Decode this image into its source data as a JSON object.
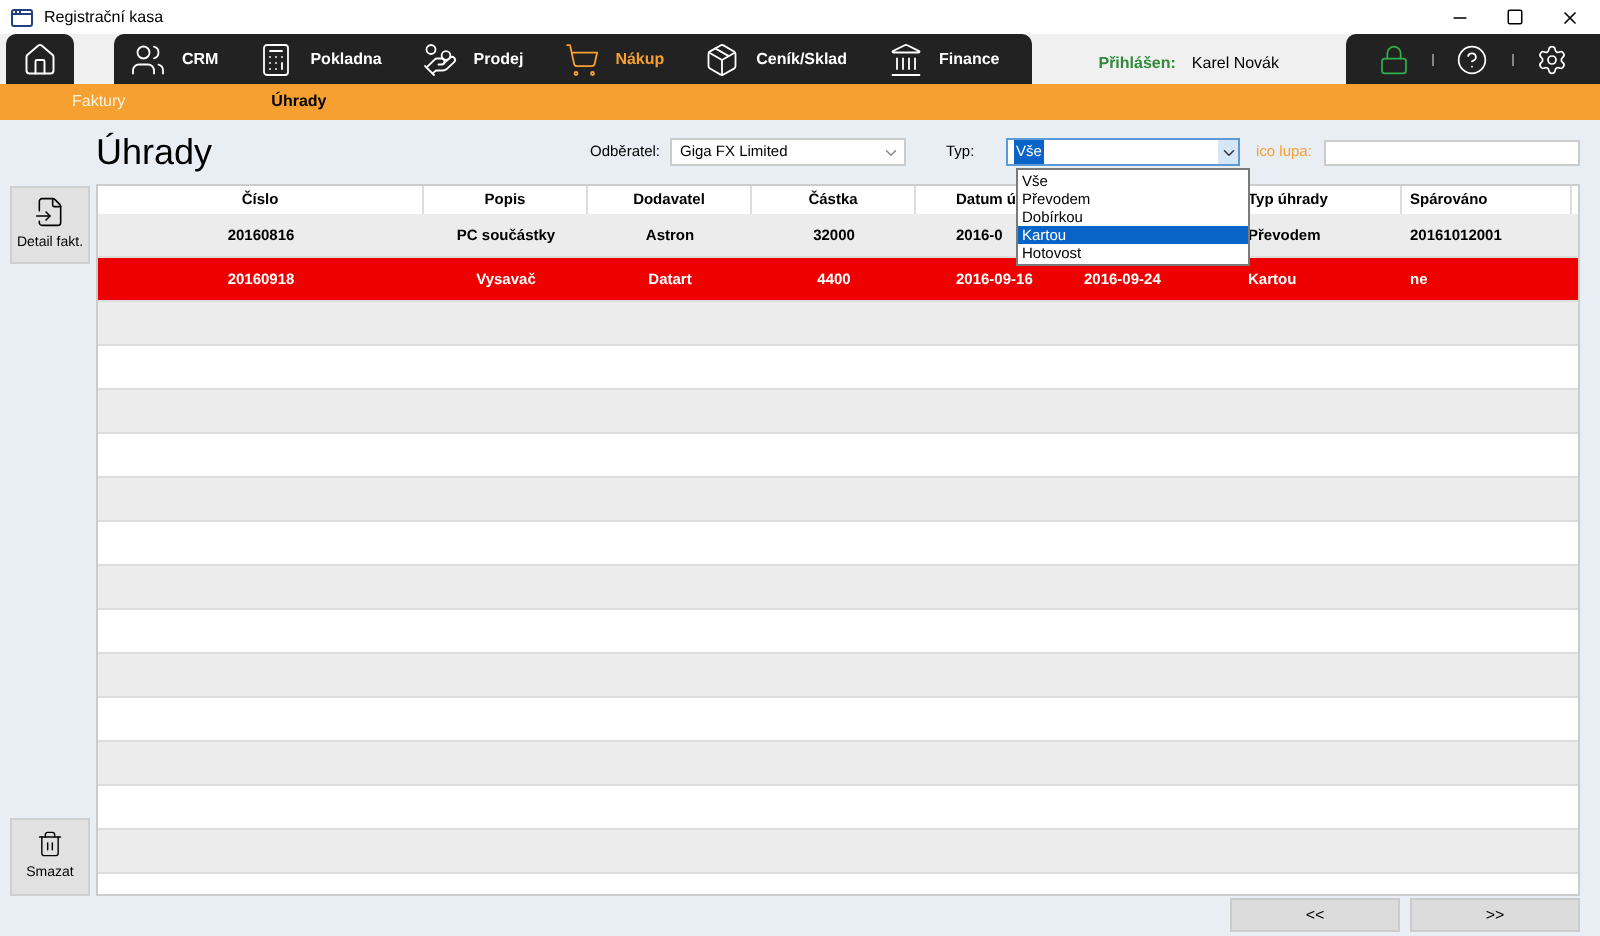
{
  "window": {
    "title": "Registrační kasa"
  },
  "nav": {
    "tabs": [
      {
        "kind": "home",
        "selected": false
      },
      {
        "kind": "crm",
        "label": "CRM",
        "selected": false
      },
      {
        "kind": "register",
        "label": "Pokladna",
        "selected": false
      },
      {
        "kind": "sale",
        "label": "Prodej",
        "selected": false
      },
      {
        "kind": "purchase",
        "label": "Nákup",
        "selected": true
      },
      {
        "kind": "stock",
        "label": "Ceník/Sklad",
        "selected": false
      },
      {
        "kind": "finance",
        "label": "Finance",
        "selected": false
      }
    ]
  },
  "user": {
    "label": "Přihlášen:",
    "name": "Karel Novák"
  },
  "subnav": [
    {
      "label": "Faktury",
      "selected": false
    },
    {
      "label": "Úhrady",
      "selected": true
    }
  ],
  "page_title": "Úhrady",
  "filters": {
    "customer_label": "Odběratel:",
    "customer_value": "Giga FX Limited",
    "type_label": "Typ:",
    "type_value": "Vše",
    "search_label": "ico lupa:"
  },
  "type_dropdown": {
    "options": [
      {
        "label": "Vše",
        "selected": false
      },
      {
        "label": "Převodem",
        "selected": false
      },
      {
        "label": "Dobírkou",
        "selected": false
      },
      {
        "label": "Kartou",
        "selected": true
      },
      {
        "label": "Hotovost",
        "selected": false
      }
    ]
  },
  "side_buttons": [
    {
      "kind": "detail",
      "label": "Detail fakt."
    },
    {
      "kind": "delete",
      "label": "Smazat"
    }
  ],
  "table": {
    "columns": [
      {
        "label": "Číslo"
      },
      {
        "label": "Popis"
      },
      {
        "label": "Dodavatel"
      },
      {
        "label": "Částka"
      },
      {
        "label": "Datum ú"
      },
      {},
      {
        "label": "Typ úhrady"
      },
      {
        "label": "Spárováno"
      }
    ],
    "rows": [
      {
        "selected": false,
        "cells": [
          "20160816",
          "PC součástky",
          "Astron",
          "32000",
          "2016-0",
          null,
          "Převodem",
          "20161012001"
        ]
      },
      {
        "selected": true,
        "cells": [
          "20160918",
          "Vysavač",
          "Datart",
          "4400",
          "2016-09-16",
          "2016-09-24",
          "Kartou",
          "ne"
        ]
      }
    ]
  },
  "pager": [
    "<<",
    ">>"
  ]
}
